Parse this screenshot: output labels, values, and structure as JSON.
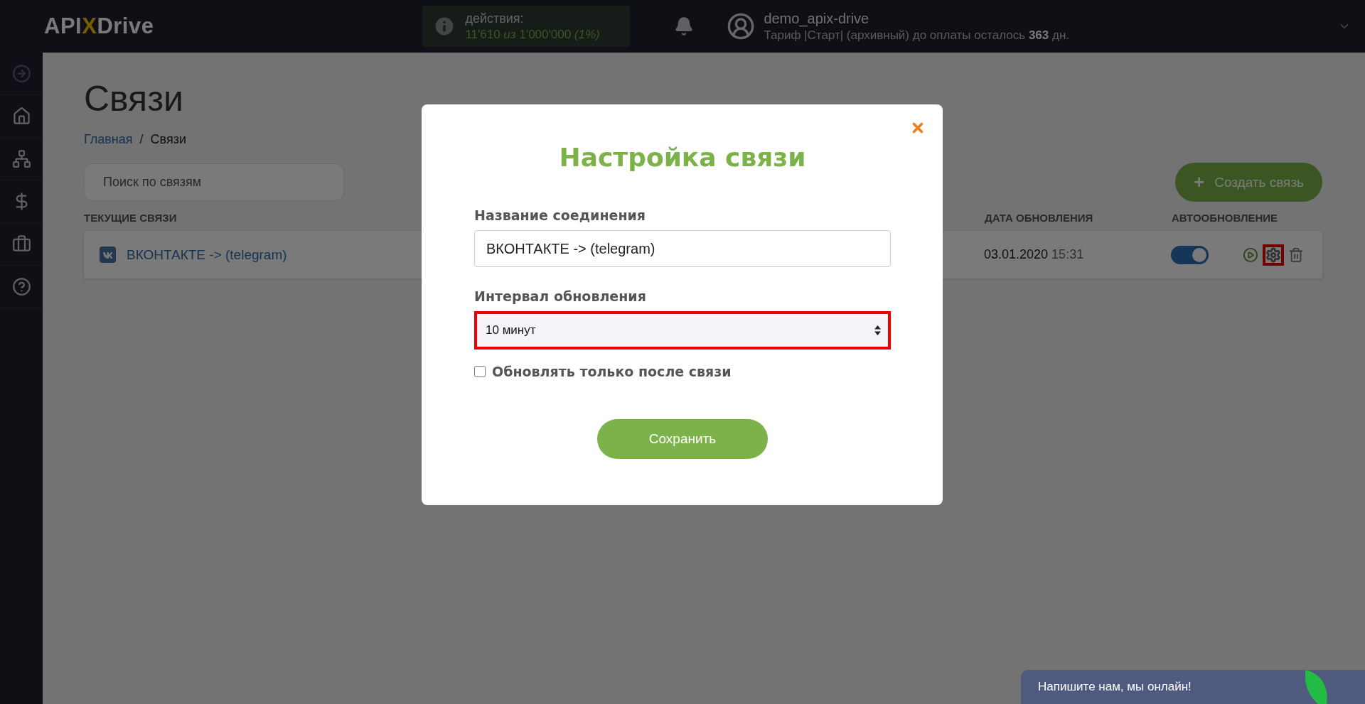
{
  "header": {
    "logo": [
      "API",
      "X",
      "Drive"
    ],
    "stats": {
      "label": "действия:",
      "value": "11'610 *из* 1'000'000 *(1%)*"
    },
    "user": {
      "name": "demo_apix-drive",
      "plan": "Тариф |Старт| (архивный) до оплаты осталось **363** дн."
    }
  },
  "sidebar": {
    "items": [
      {
        "kind": "arrow",
        "dim": true
      },
      {
        "kind": "home",
        "dim": false
      },
      {
        "kind": "network",
        "dim": false
      },
      {
        "kind": "dollar",
        "dim": false
      },
      {
        "kind": "briefcase",
        "dim": false
      },
      {
        "kind": "help",
        "dim": false
      }
    ]
  },
  "page": {
    "title": "Связи",
    "breadcrumb_separator": "/",
    "breadcrumb": [
      {
        "label": "Главная",
        "link": true
      },
      {
        "label": "Связи",
        "link": false
      }
    ],
    "search": {
      "placeholder": "Поиск по связям"
    },
    "create_button": {
      "icon": "+",
      "label": "Создать связь"
    }
  },
  "table": {
    "columns": [
      "ТЕКУЩИЕ СВЯЗИ",
      "ДАТА ОБНОВЛЕНИЯ",
      "АВТООБНОВЛЕНИЕ"
    ],
    "rows": [
      {
        "name": "ВКОНТАКТЕ -> (telegram)",
        "date": "03.01.2020",
        "time": "15:31",
        "autoupdate": true,
        "actions": [
          {
            "kind": "play",
            "highlighted": false
          },
          {
            "kind": "settings",
            "highlighted": true
          },
          {
            "kind": "delete",
            "highlighted": false
          }
        ]
      }
    ]
  },
  "modal": {
    "title": "Настройка связи",
    "fields": [
      {
        "kind": "text",
        "label": "Название соединения",
        "value": "ВКОНТАКТЕ -> (telegram)",
        "highlighted": false
      },
      {
        "kind": "select",
        "label": "Интервал обновления",
        "value": "10 минут",
        "highlighted": true
      }
    ],
    "checkbox": {
      "label": "Обновлять только после связи",
      "checked": false
    },
    "save_button": "Сохранить"
  },
  "chat": {
    "text": "Напишите нам, мы онлайн!"
  }
}
